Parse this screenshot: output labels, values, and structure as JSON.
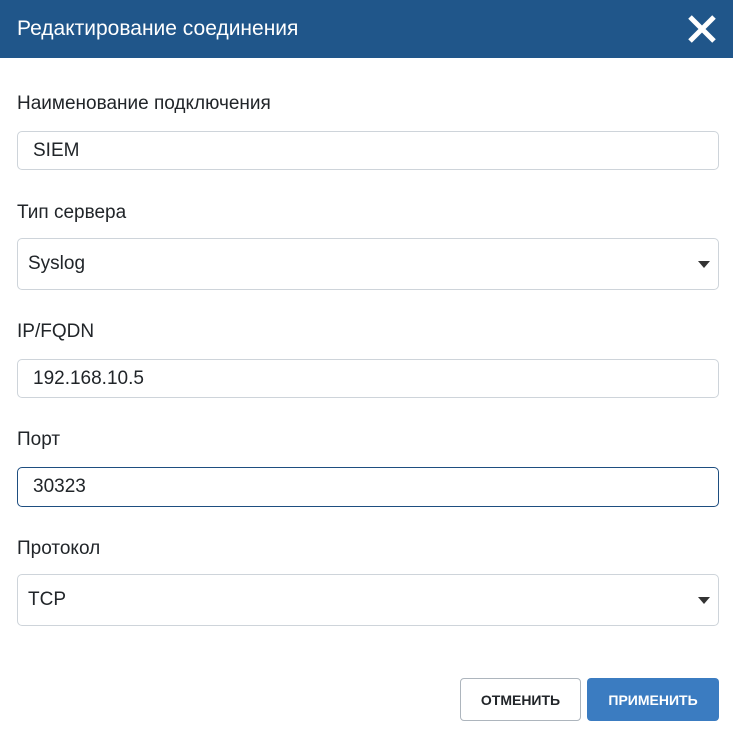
{
  "header": {
    "title": "Редактирование соединения"
  },
  "fields": {
    "connection_name": {
      "label": "Наименование подключения",
      "value": "SIEM"
    },
    "server_type": {
      "label": "Тип сервера",
      "value": "Syslog"
    },
    "ip_fqdn": {
      "label": "IP/FQDN",
      "value": "192.168.10.5"
    },
    "port": {
      "label": "Порт",
      "value": "30323"
    },
    "protocol": {
      "label": "Протокол",
      "value": "TCP"
    }
  },
  "buttons": {
    "cancel": "ОТМЕНИТЬ",
    "apply": "ПРИМЕНИТЬ"
  },
  "colors": {
    "header_bg": "#20568a",
    "apply_bg": "#3b7cc1"
  }
}
